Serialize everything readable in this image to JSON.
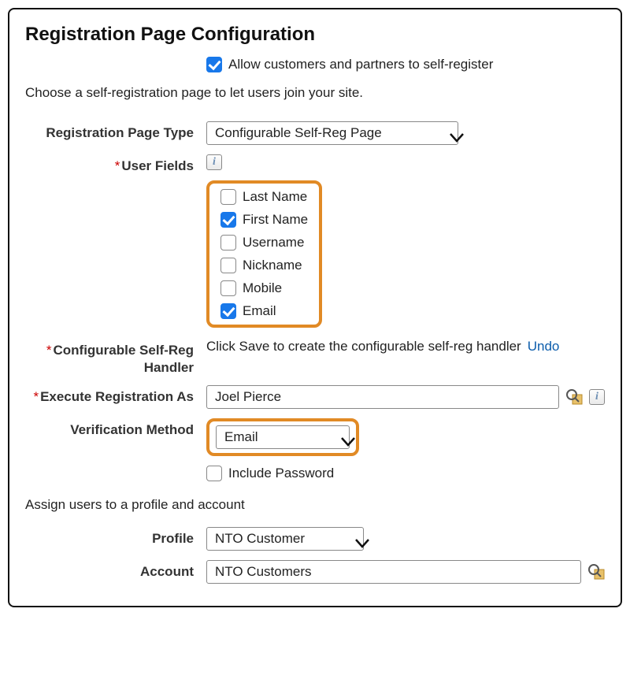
{
  "title": "Registration Page Configuration",
  "allow": {
    "checked": true,
    "label": "Allow customers and partners to self-register"
  },
  "instruction": "Choose a self-registration page to let users join your site.",
  "labels": {
    "reg_page_type": "Registration Page Type",
    "user_fields": "User Fields",
    "handler": "Configurable Self-Reg Handler",
    "execute_as": "Execute Registration As",
    "verification": "Verification Method",
    "profile": "Profile",
    "account": "Account"
  },
  "reg_page_type_value": "Configurable Self-Reg Page",
  "user_fields": [
    {
      "label": "Last Name",
      "checked": false
    },
    {
      "label": "First Name",
      "checked": true
    },
    {
      "label": "Username",
      "checked": false
    },
    {
      "label": "Nickname",
      "checked": false
    },
    {
      "label": "Mobile",
      "checked": false
    },
    {
      "label": "Email",
      "checked": true
    }
  ],
  "handler_msg": "Click Save to create the configurable self-reg handler ",
  "handler_undo": "Undo",
  "execute_as_value": "Joel Pierce",
  "verification_value": "Email",
  "include_password": {
    "checked": false,
    "label": "Include Password"
  },
  "assign_heading": "Assign users to a profile and account",
  "profile_value": "NTO Customer",
  "account_value": "NTO Customers"
}
